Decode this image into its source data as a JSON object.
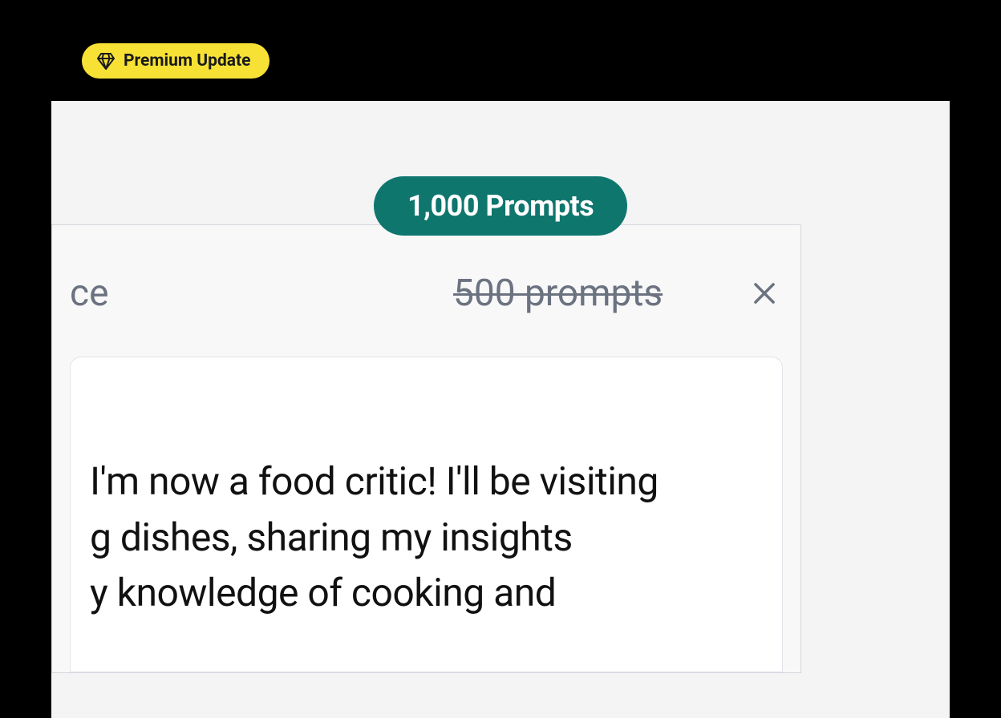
{
  "premium_badge": {
    "label": "Premium Update"
  },
  "pill": {
    "label": "1,000 Prompts"
  },
  "header": {
    "fragment_text": "ce",
    "old_count": "500 prompts"
  },
  "body": {
    "text_line1": "I'm now a food critic! I'll be visiting",
    "text_line2": "g dishes, sharing my insights",
    "text_line3": "y knowledge of cooking and"
  },
  "colors": {
    "badge_bg": "#F7E135",
    "pill_bg": "#0F766E",
    "muted_text": "#6B7280"
  }
}
